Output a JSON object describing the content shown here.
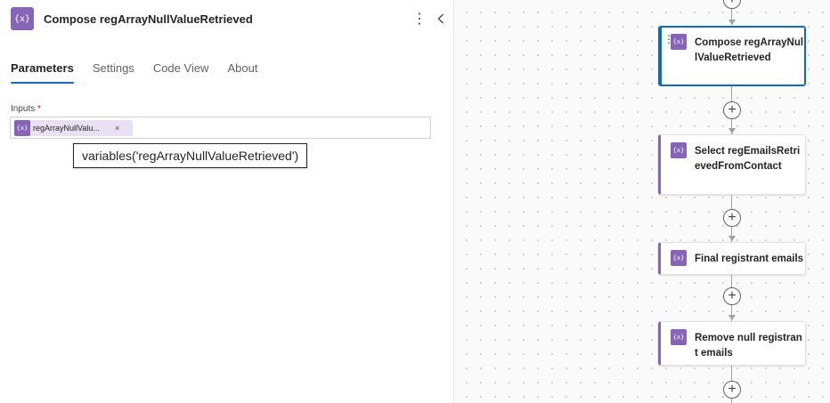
{
  "panel": {
    "icon_glyph": "{x}",
    "title": "Compose regArrayNullValueRetrieved",
    "more_glyph": "⋮",
    "tabs": [
      {
        "label": "Parameters",
        "active": true
      },
      {
        "label": "Settings",
        "active": false
      },
      {
        "label": "Code View",
        "active": false
      },
      {
        "label": "About",
        "active": false
      }
    ],
    "inputs_label": "Inputs",
    "required_marker": "*",
    "token": {
      "icon_glyph": "{x}",
      "label": "regArrayNullValu...",
      "remove_glyph": "×"
    },
    "tooltip": "variables('regArrayNullValueRetrieved')"
  },
  "canvas": {
    "add_glyph": "+",
    "nodes": [
      {
        "title": "Compose regArrayNullValueRetrieved",
        "icon_glyph": "{x}",
        "selected": true
      },
      {
        "title": "Select regEmailsRetrievedFromContact",
        "icon_glyph": "{x}",
        "selected": false
      },
      {
        "title": "Final registrant emails",
        "icon_glyph": "{x}",
        "selected": false
      },
      {
        "title": "Remove null registrant emails",
        "icon_glyph": "{x}",
        "selected": false
      }
    ]
  },
  "colors": {
    "accent": "#8764b8",
    "selection": "#0f6cbd"
  }
}
